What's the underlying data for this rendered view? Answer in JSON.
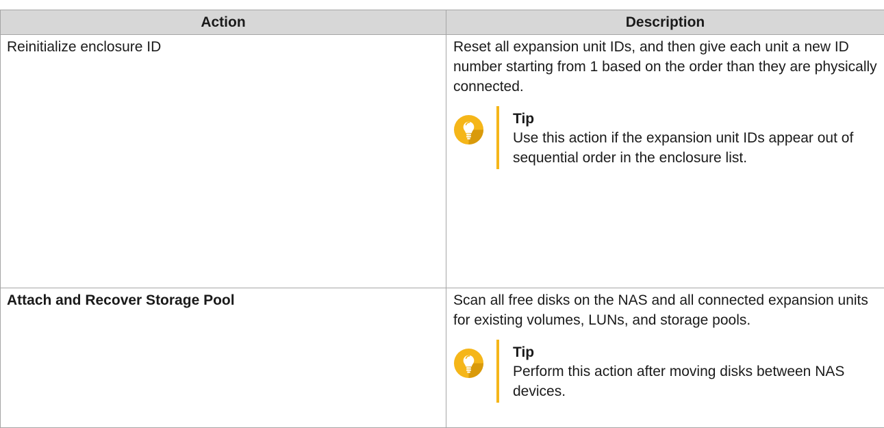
{
  "table": {
    "headers": {
      "action": "Action",
      "description": "Description"
    },
    "rows": [
      {
        "action": "Reinitialize enclosure ID",
        "description": "Reset all expansion unit IDs, and then give each unit a new ID number starting from 1 based on the order than they are physically connected.",
        "tip": {
          "title": "Tip",
          "text": "Use this action if the expansion unit IDs appear out of sequential order in the enclosure list."
        }
      },
      {
        "action": "Attach and Recover Storage Pool",
        "description": "Scan all free disks on the NAS and all connected expansion units for existing volumes, LUNs, and storage pools.",
        "tip": {
          "title": "Tip",
          "text": "Perform this action after moving disks between NAS devices."
        }
      }
    ]
  },
  "colors": {
    "header_bg": "#d7d7d7",
    "border": "#a5a5a5",
    "tip_accent": "#f5b619"
  },
  "icons": {
    "tip_icon": "lightbulb-icon"
  }
}
